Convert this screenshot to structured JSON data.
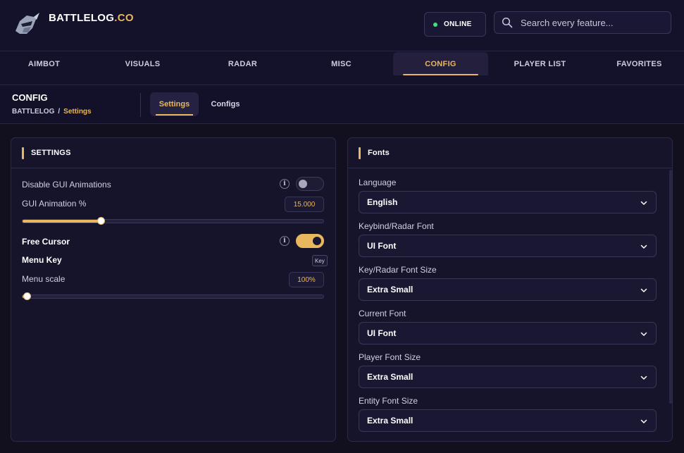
{
  "header": {
    "brand_main": "BATTLELOG",
    "brand_accent": ".CO",
    "status": "ONLINE",
    "search_placeholder": "Search every feature..."
  },
  "nav": {
    "items": [
      "AIMBOT",
      "VISUALS",
      "RADAR",
      "MISC",
      "CONFIG",
      "PLAYER LIST",
      "FAVORITES"
    ],
    "active": "CONFIG"
  },
  "subheader": {
    "title": "CONFIG",
    "breadcrumb_root": "BATTLELOG",
    "breadcrumb_sep": "/",
    "breadcrumb_current": "Settings",
    "tabs": [
      "Settings",
      "Configs"
    ],
    "active_tab": "Settings"
  },
  "settings": {
    "title": "SETTINGS",
    "disable_anim_label": "Disable GUI Animations",
    "disable_anim_on": false,
    "anim_pct_label": "GUI Animation %",
    "anim_pct_value": "15.000",
    "anim_pct_fraction": 0.26,
    "free_cursor_label": "Free Cursor",
    "free_cursor_on": true,
    "menu_key_label": "Menu Key",
    "menu_key_value": "Key",
    "menu_scale_label": "Menu scale",
    "menu_scale_value": "100%",
    "menu_scale_fraction": 0.015,
    "info_glyph": "i"
  },
  "fonts": {
    "title": "Fonts",
    "fields": [
      {
        "label": "Language",
        "value": "English"
      },
      {
        "label": "Keybind/Radar Font",
        "value": "UI Font"
      },
      {
        "label": "Key/Radar Font Size",
        "value": "Extra Small"
      },
      {
        "label": "Current Font",
        "value": "UI Font"
      },
      {
        "label": "Player Font Size",
        "value": "Extra Small"
      },
      {
        "label": "Entity Font Size",
        "value": "Extra Small"
      }
    ]
  },
  "colors": {
    "accent": "#e8b75e",
    "background": "#12101f",
    "online": "#3ee27a"
  }
}
